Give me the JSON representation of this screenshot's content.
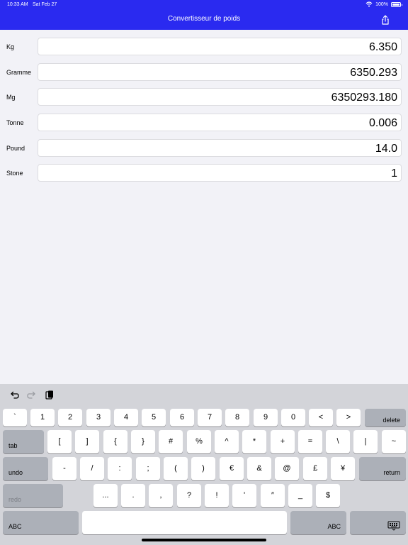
{
  "status": {
    "time": "10:33 AM",
    "date": "Sat Feb 27",
    "battery": "100%",
    "battery_level": 1.0
  },
  "nav": {
    "title": "Convertisseur de poids",
    "share_icon": "share-icon"
  },
  "rows": [
    {
      "label": "Kg",
      "value": "6.350"
    },
    {
      "label": "Gramme",
      "value": "6350.293"
    },
    {
      "label": "Mg",
      "value": "6350293.180"
    },
    {
      "label": "Tonne",
      "value": "0.006"
    },
    {
      "label": "Pound",
      "value": "14.0"
    },
    {
      "label": "Stone",
      "value": "1"
    }
  ],
  "shortcuts": {
    "undo_icon": "undo-icon",
    "redo_icon": "redo-icon",
    "paste_icon": "paste-icon"
  },
  "keyboard": {
    "row1": [
      "`",
      "1",
      "2",
      "3",
      "4",
      "5",
      "6",
      "7",
      "8",
      "9",
      "0",
      "<",
      ">"
    ],
    "delete": "delete",
    "tab": "tab",
    "row2": [
      "[",
      "]",
      "{",
      "}",
      "#",
      "%",
      "^",
      "*",
      "+",
      "=",
      "\\",
      "|",
      "~"
    ],
    "undo": "undo",
    "row3": [
      "-",
      "/",
      ":",
      ";",
      "(",
      ")",
      "€",
      "&",
      "@",
      "£",
      "¥"
    ],
    "return": "return",
    "redo": "redo",
    "row4": [
      "...",
      ".",
      ",",
      "?",
      "!",
      "'",
      "″",
      "_",
      "$"
    ],
    "abc_left": "ABC",
    "abc_right": "ABC",
    "dismiss_icon": "keyboard-dismiss-icon"
  }
}
